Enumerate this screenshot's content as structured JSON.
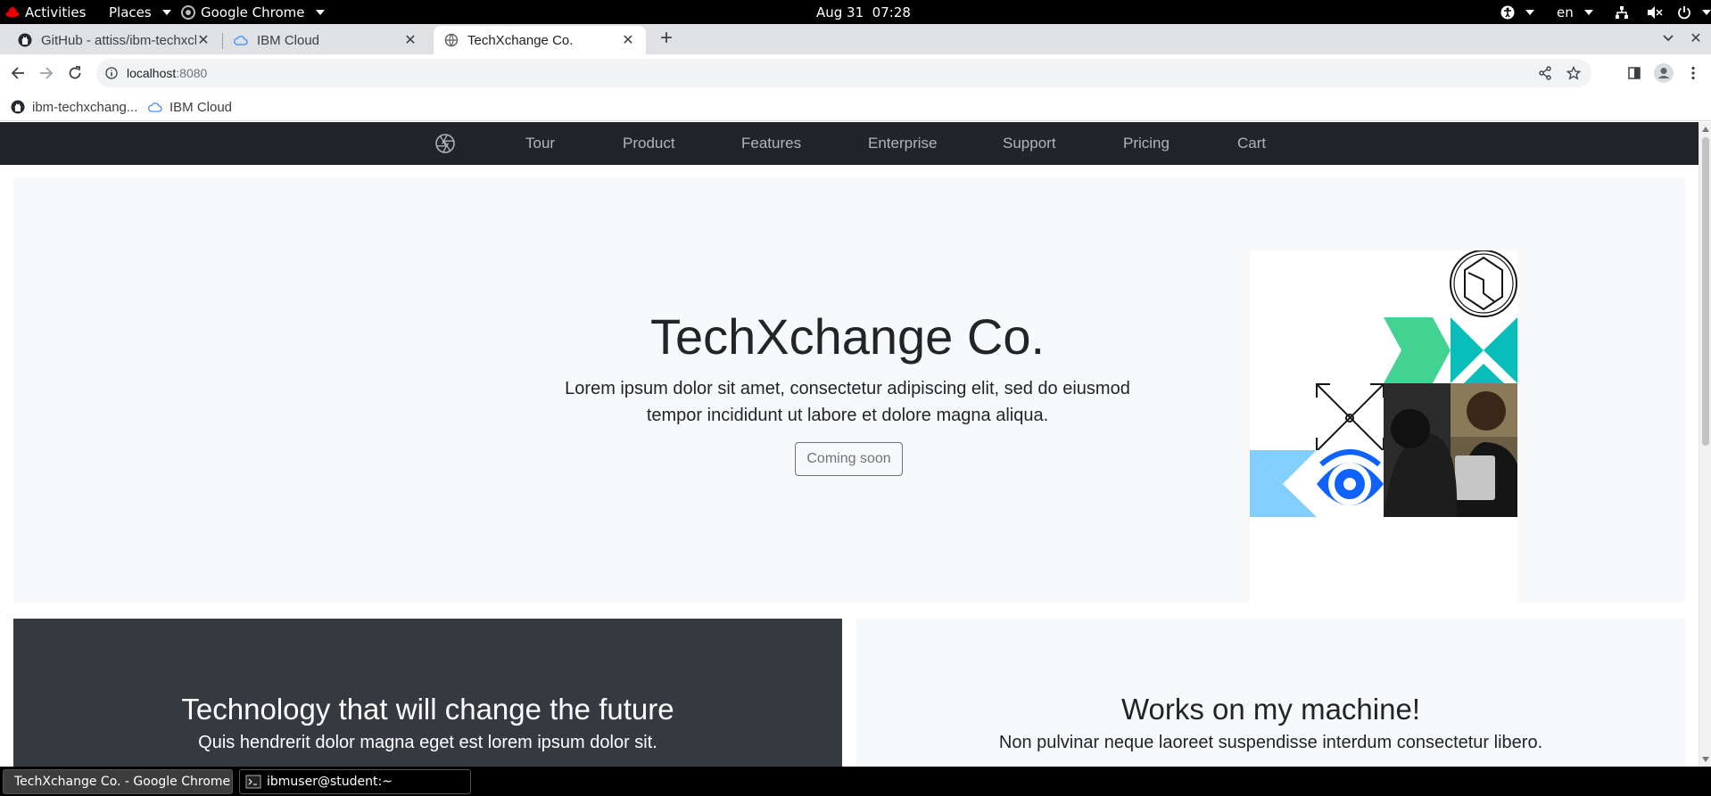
{
  "topbar": {
    "activities": "Activities",
    "places": "Places",
    "app": "Google Chrome",
    "clock": "Aug 31  07:28",
    "lang": "en"
  },
  "browser": {
    "tabs": [
      {
        "label": "GitHub - attiss/ibm-techxch",
        "icon": "github-icon"
      },
      {
        "label": "IBM Cloud",
        "icon": "cloud-icon"
      },
      {
        "label": "TechXchange Co.",
        "icon": "globe-icon",
        "active": true
      }
    ],
    "url_host": "localhost",
    "url_port": ":8080",
    "bookmarks": [
      {
        "label": "ibm-techxchang...",
        "icon": "github-icon"
      },
      {
        "label": "IBM Cloud",
        "icon": "cloud-icon"
      }
    ]
  },
  "site": {
    "nav": [
      "Tour",
      "Product",
      "Features",
      "Enterprise",
      "Support",
      "Pricing",
      "Cart"
    ],
    "hero": {
      "title": "TechXchange Co.",
      "text": "Lorem ipsum dolor sit amet, consectetur adipiscing elit, sed do eiusmod tempor incididunt ut labore et dolore magna aliqua.",
      "button": "Coming soon"
    },
    "panels": [
      {
        "title": "Technology that will change the future",
        "subtitle": "Quis hendrerit dolor magna eget est lorem ipsum dolor sit."
      },
      {
        "title": "Works on my machine!",
        "subtitle": "Non pulvinar neque laoreet suspendisse interdum consectetur libero."
      }
    ]
  },
  "taskbar": {
    "items": [
      {
        "label": "TechXchange Co. - Google Chrome",
        "active": true
      },
      {
        "label": "ibmuser@student:~",
        "active": false
      }
    ]
  },
  "colors": {
    "site_nav_bg": "#212529",
    "hero_bg": "#f8f9fa",
    "panel_dark_bg": "#343a40",
    "accent_green": "#42d392",
    "accent_teal": "#08bdba",
    "accent_light_blue": "#82cfff",
    "accent_blue": "#0f62fe"
  }
}
